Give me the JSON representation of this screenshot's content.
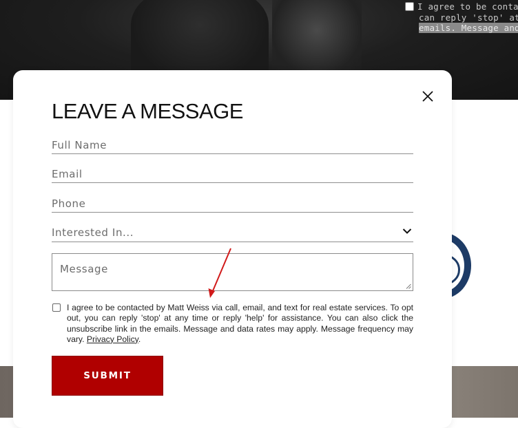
{
  "background": {
    "consent_lines": [
      "I agree to be contact",
      "can reply 'stop' at an",
      "emails. Message and"
    ]
  },
  "modal": {
    "title": "LEAVE A MESSAGE",
    "fields": {
      "full_name_placeholder": "Full Name",
      "email_placeholder": "Email",
      "phone_placeholder": "Phone",
      "interested_label": "Interested In...",
      "message_placeholder": "Message"
    },
    "consent": {
      "text": "I agree to be contacted by Matt Weiss via call, email, and text for real estate services. To opt out, you can reply 'stop' at any time or reply 'help' for assistance. You can also click the unsubscribe link in the emails. Message and data rates may apply. Message frequency may vary.",
      "link": "Privacy Policy",
      "tail": "."
    },
    "submit_label": "SUBMIT"
  },
  "colors": {
    "submit_bg": "#b00000",
    "annotation_arrow": "#d11a1a",
    "badge_ring": "#1d3b66"
  },
  "icons": [
    "close-icon",
    "chevron-down-icon",
    "resize-grip-icon",
    "annotation-arrow"
  ]
}
